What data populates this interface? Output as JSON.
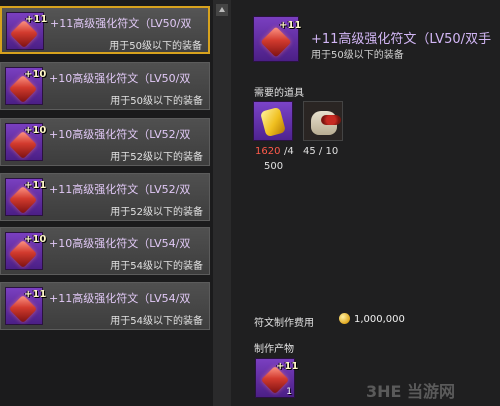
{
  "list": {
    "items": [
      {
        "level": "+11",
        "title": "+11高级强化符文（LV50/双",
        "desc": "用于50级以下的装备"
      },
      {
        "level": "+10",
        "title": "+10高级强化符文（LV50/双",
        "desc": "用于50级以下的装备"
      },
      {
        "level": "+10",
        "title": "+10高级强化符文（LV52/双",
        "desc": "用于52级以下的装备"
      },
      {
        "level": "+11",
        "title": "+11高级强化符文（LV52/双",
        "desc": "用于52级以下的装备"
      },
      {
        "level": "+10",
        "title": "+10高级强化符文（LV54/双",
        "desc": "用于54级以下的装备"
      },
      {
        "level": "+11",
        "title": "+11高级强化符文（LV54/双",
        "desc": "用于54级以下的装备"
      }
    ]
  },
  "detail": {
    "level": "+11",
    "title": "+11高级强化符文（LV50/双手",
    "desc": "用于50级以下的装备",
    "required_label": "需要的道具",
    "req1_have": "1620",
    "req1_need": "/4",
    "req1_need2": "500",
    "req2_count": "45 / 10",
    "fee_label": "符文制作费用",
    "fee_value": "1,000,000",
    "product_label": "制作产物",
    "product_count": "1"
  },
  "watermark": "3HE 当游网",
  "colors": {
    "accent": "#d7a21e",
    "rune_purple": "#6a35b0",
    "warning_red": "#ff5a4a"
  }
}
